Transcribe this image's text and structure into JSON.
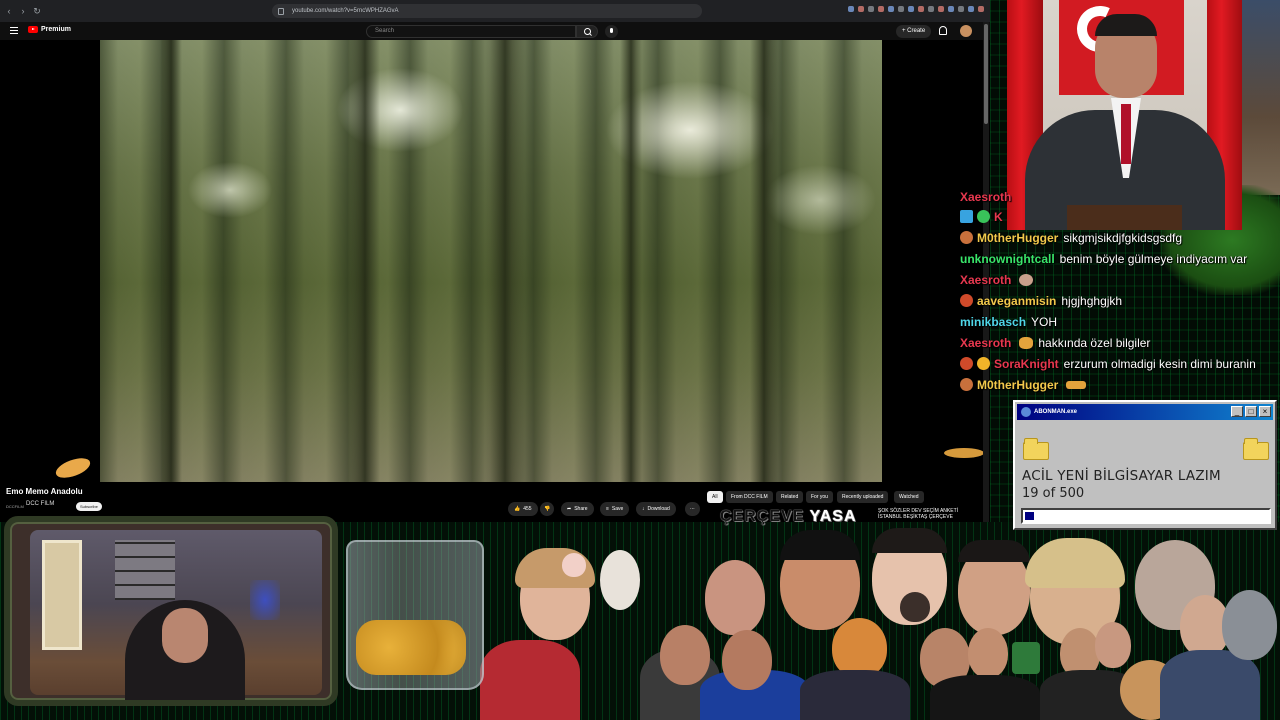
{
  "browser": {
    "url": "youtube.com/watch?v=5rncWPHZAGvA"
  },
  "youtube": {
    "logo_text": "Premium",
    "search_placeholder": "Search",
    "create_label": "+ Create"
  },
  "video": {
    "title": "Emo Memo Anadolu",
    "channel": "DCC FILM",
    "channel_avatar_text": "DCCFILM",
    "subscribe_label": "Subscribe",
    "likes": "455",
    "actions": [
      "Share",
      "Save",
      "Download"
    ],
    "chips": [
      "All",
      "From DCC FILM",
      "Related",
      "For you",
      "Recently uploaded",
      "Watched"
    ]
  },
  "overlay_banner": {
    "cerceve_part1": "ÇERÇEVE ",
    "cerceve_part2": "YASA",
    "ticker": "ŞOK SÖZLER DEV SEÇİM ANKETİ İSTANBUL BEŞİKTAŞ ÇERÇEVE"
  },
  "chat": [
    {
      "user": "Xaesroth",
      "color": "#e8384f",
      "message": "",
      "badge": ""
    },
    {
      "user": "K",
      "color": "#e8384f",
      "message": "",
      "badge": "#38a3e0"
    },
    {
      "user": "M0therHugger",
      "color": "#f2c94c",
      "message": "sikgmjsikdjfgkidsgsdfg",
      "badge": "#c8703c"
    },
    {
      "user": "unknownightcall",
      "color": "#39e66a",
      "message": "benim böyle gülmeye indiyacım var",
      "badge": ""
    },
    {
      "user": "Xaesroth",
      "color": "#e8384f",
      "message": "",
      "badge": ""
    },
    {
      "user": "aaveganmisin",
      "color": "#f2c94c",
      "message": "hjgjhghgjkh",
      "badge": "#d04a2a"
    },
    {
      "user": "minikbasch",
      "color": "#4fd6e8",
      "message": "YOH",
      "badge": ""
    },
    {
      "user": "Xaesroth",
      "color": "#e8384f",
      "message": "hakkında özel bilgiler",
      "badge": ""
    },
    {
      "user": "SoraKnight",
      "color": "#e8384f",
      "message": "erzurum olmadigi kesin dimi buranin",
      "badge": "#d04a2a"
    },
    {
      "user": "M0therHugger",
      "color": "#f2c94c",
      "message": "",
      "badge": "#c8703c"
    }
  ],
  "retro_window": {
    "title": "ABONMAN.exe",
    "heading": "ACİL YENİ BİLGİSAYAR LAZIM",
    "count_text": "19 of 500",
    "progress_fraction": 0.038,
    "controls": [
      "_",
      "□",
      "×"
    ]
  },
  "colors": {
    "youtube_bg": "#0f0f0f",
    "retro_titlebar": "#000080",
    "progress_fill": "#000080",
    "matrix_green": "#00a03c"
  }
}
